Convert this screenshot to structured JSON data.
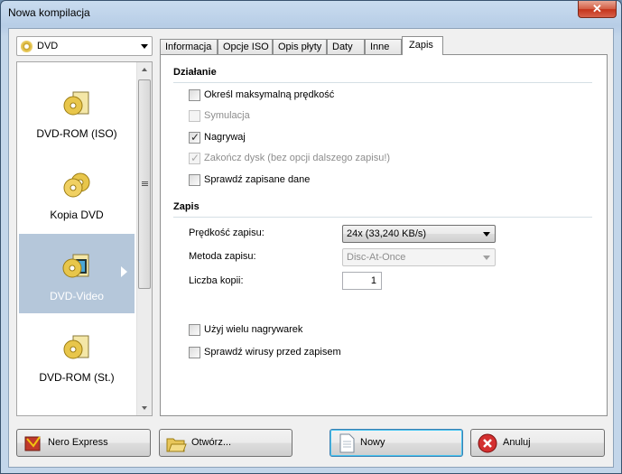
{
  "window": {
    "title": "Nowa kompilacja",
    "close_glyph": "✕"
  },
  "type_select": {
    "value": "DVD",
    "icon": "disc-icon"
  },
  "side_list": {
    "items": [
      {
        "label": "DVD-ROM (ISO)",
        "icon": "dvd-rom-icon"
      },
      {
        "label": "Kopia DVD",
        "icon": "copy-dvd-icon"
      },
      {
        "label": "DVD-Video",
        "icon": "dvd-video-icon",
        "selected": true
      },
      {
        "label": "DVD-ROM (St.)",
        "icon": "dvd-rom-boot-icon"
      }
    ]
  },
  "tabs": [
    {
      "label": "Informacja"
    },
    {
      "label": "Opcje ISO"
    },
    {
      "label": "Opis płyty"
    },
    {
      "label": "Daty"
    },
    {
      "label": "Inne"
    },
    {
      "label": "Zapis",
      "active": true
    }
  ],
  "panel": {
    "section_action": "Działanie",
    "checkboxes_action": [
      {
        "label": "Określ maksymalną prędkość",
        "checked": false,
        "disabled": false
      },
      {
        "label": "Symulacja",
        "checked": false,
        "disabled": true
      },
      {
        "label": "Nagrywaj",
        "checked": true,
        "disabled": false
      },
      {
        "label": "Zakończ dysk (bez opcji dalszego zapisu!)",
        "checked": true,
        "disabled": true
      },
      {
        "label": "Sprawdź zapisane dane",
        "checked": false,
        "disabled": false
      }
    ],
    "section_write": "Zapis",
    "speed_label": "Prędkość zapisu:",
    "speed_value": "24x (33,240 KB/s)",
    "method_label": "Metoda zapisu:",
    "method_value": "Disc-At-Once",
    "copies_label": "Liczba kopii:",
    "copies_value": "1",
    "checkboxes_extra": [
      {
        "label": "Użyj wielu nagrywarek",
        "checked": false
      },
      {
        "label": "Sprawdź wirusy przed zapisem",
        "checked": false
      }
    ],
    "check_glyph": "✓"
  },
  "buttons": {
    "nero_express": "Nero Express",
    "open": "Otwórz...",
    "new": "Nowy",
    "cancel": "Anuluj"
  },
  "colors": {
    "selection": "#b5c7da",
    "accent": "#3c7fb1"
  }
}
